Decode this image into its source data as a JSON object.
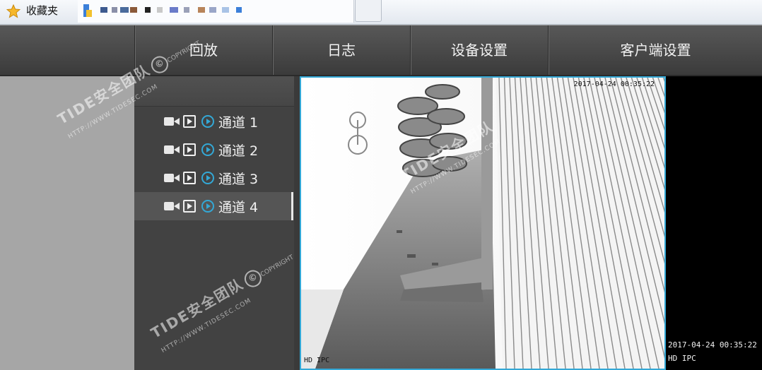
{
  "browser": {
    "favorites_label": "收藏夹",
    "star_icon": "star-icon"
  },
  "nav": {
    "items": [
      {
        "label": "回放"
      },
      {
        "label": "日志"
      },
      {
        "label": "设备设置"
      },
      {
        "label": "客户端设置"
      }
    ]
  },
  "sidebar": {
    "channels": [
      {
        "label": "通道 1",
        "active": false
      },
      {
        "label": "通道 2",
        "active": false
      },
      {
        "label": "通道 3",
        "active": false
      },
      {
        "label": "通道 4",
        "active": true
      }
    ],
    "icons": [
      "camera-icon",
      "playback-icon",
      "live-view-icon"
    ]
  },
  "video": {
    "timestamp_top": "2017-04-24 00:35:22",
    "label_bottom": "HD IPC",
    "side_timestamp": "2017-04-24 00:35:22",
    "side_label": "HD IPC"
  },
  "watermark": {
    "text": "TIDE安全团队",
    "url": "HTTP://WWW.TIDESEC.COM",
    "copyright_symbol": "©",
    "copyright_word": "COPYRIGHT"
  },
  "colors": {
    "accent": "#33a8d6",
    "nav_bg": "#474747",
    "sidebar_bg": "#424242"
  }
}
